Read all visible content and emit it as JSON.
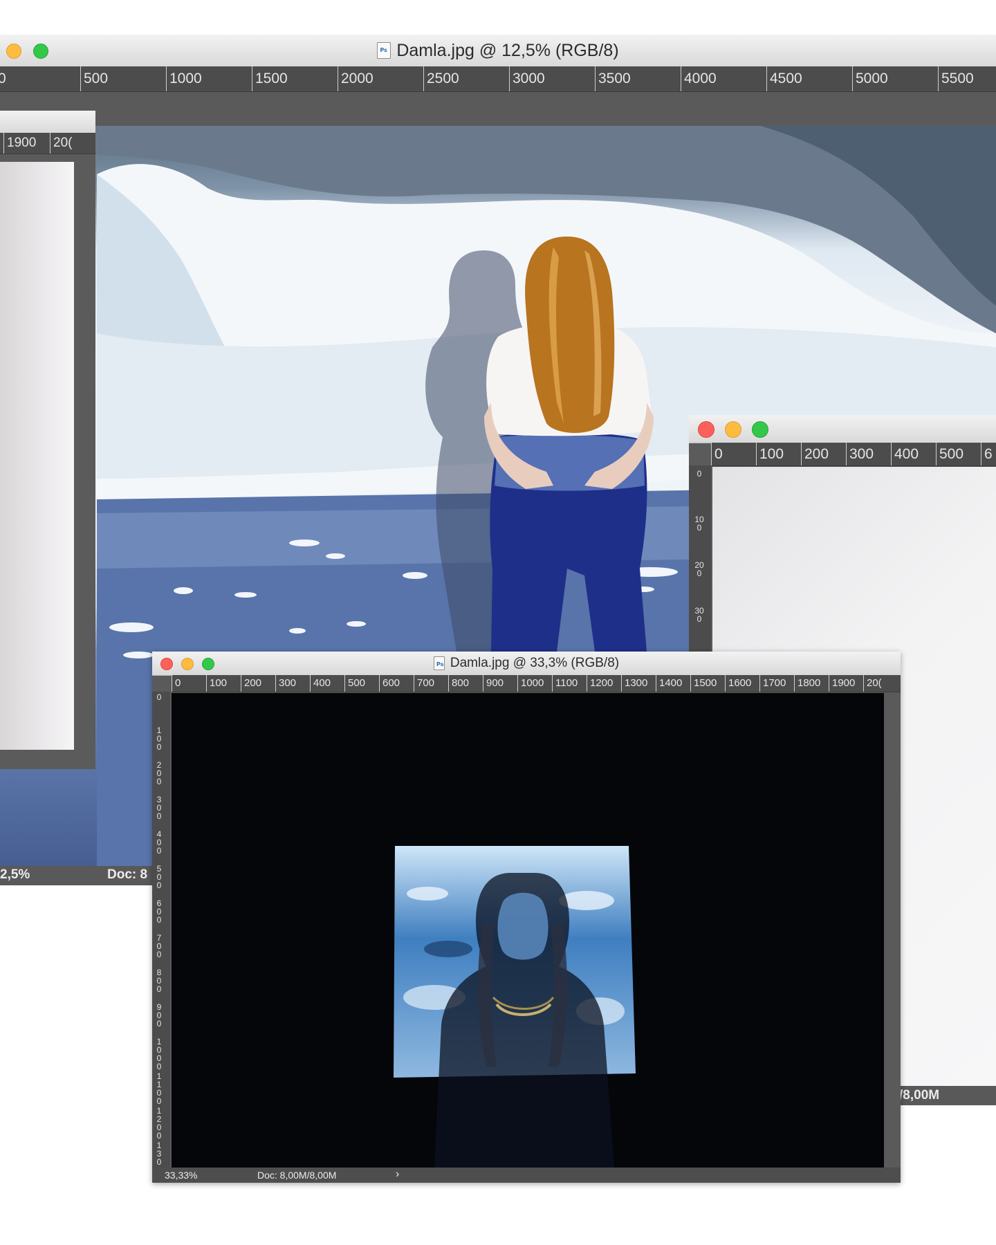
{
  "windows": {
    "main": {
      "title": "Damla.jpg @ 12,5% (RGB/8)",
      "ruler_labels": [
        "0",
        "500",
        "1000",
        "1500",
        "2000",
        "2500",
        "3000",
        "3500",
        "4000",
        "4500",
        "5000",
        "5500"
      ],
      "zoom": "2,5%",
      "doc": "Doc: 8"
    },
    "left": {
      "ruler_labels": [
        "1900",
        "20("
      ]
    },
    "right": {
      "ruler_labels": [
        "0",
        "100",
        "200",
        "300",
        "400",
        "500",
        "6"
      ],
      "vruler_labels": [
        "0",
        "100",
        "200",
        "300"
      ],
      "doc": "/8,00M"
    },
    "front": {
      "title": "Damla.jpg @ 33,3% (RGB/8)",
      "ruler_labels": [
        "0",
        "100",
        "200",
        "300",
        "400",
        "500",
        "600",
        "700",
        "800",
        "900",
        "1000",
        "1100",
        "1200",
        "1300",
        "1400",
        "1500",
        "1600",
        "1700",
        "1800",
        "1900",
        "20("
      ],
      "vruler_labels": [
        "0",
        "100",
        "200",
        "300",
        "400",
        "500",
        "600",
        "700",
        "800",
        "900",
        "1000",
        "1100",
        "1200",
        "130"
      ],
      "zoom": "33,33%",
      "doc": "Doc: 8,00M/8,00M",
      "arrow": "›"
    }
  },
  "colors": {
    "traffic_red": "#fc605b",
    "traffic_yellow": "#fdbc40",
    "traffic_green": "#34c84a"
  }
}
